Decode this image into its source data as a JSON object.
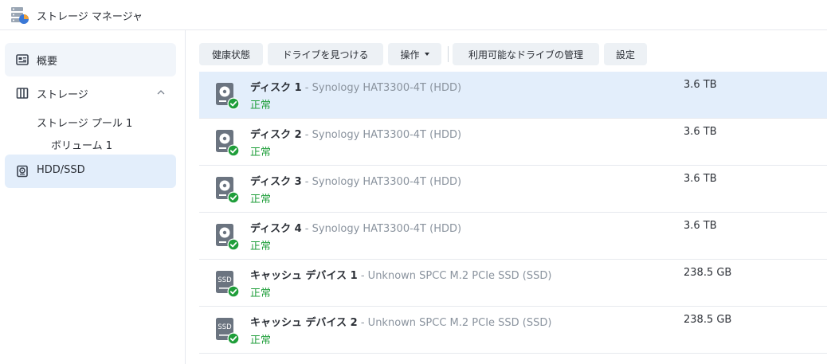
{
  "window": {
    "title": "ストレージ マネージャ"
  },
  "sidebar": {
    "overview": "概要",
    "storage": "ストレージ",
    "pool": "ストレージ プール 1",
    "volume": "ボリューム 1",
    "hdd": "HDD/SSD"
  },
  "toolbar": {
    "health": "健康状態",
    "find": "ドライブを見つける",
    "action": "操作",
    "manage": "利用可能なドライブの管理",
    "settings": "設定"
  },
  "disks": [
    {
      "name": "ディスク 1",
      "model": " - Synology HAT3300-4T (HDD)",
      "status": "正常",
      "size": "3.6 TB",
      "type": "hdd"
    },
    {
      "name": "ディスク 2",
      "model": " - Synology HAT3300-4T (HDD)",
      "status": "正常",
      "size": "3.6 TB",
      "type": "hdd"
    },
    {
      "name": "ディスク 3",
      "model": " - Synology HAT3300-4T (HDD)",
      "status": "正常",
      "size": "3.6 TB",
      "type": "hdd"
    },
    {
      "name": "ディスク 4",
      "model": " - Synology HAT3300-4T (HDD)",
      "status": "正常",
      "size": "3.6 TB",
      "type": "hdd"
    },
    {
      "name": "キャッシュ デバイス 1",
      "model": " - Unknown SPCC M.2 PCIe SSD (SSD)",
      "status": "正常",
      "size": "238.5 GB",
      "type": "ssd",
      "icon_label": "SSD"
    },
    {
      "name": "キャッシュ デバイス 2",
      "model": " - Unknown SPCC M.2 PCIe SSD (SSD)",
      "status": "正常",
      "size": "238.5 GB",
      "type": "ssd",
      "icon_label": "SSD"
    }
  ],
  "colors": {
    "selected": "#e3eefb",
    "ok": "#1f9e3a",
    "icon": "#6b7480"
  }
}
